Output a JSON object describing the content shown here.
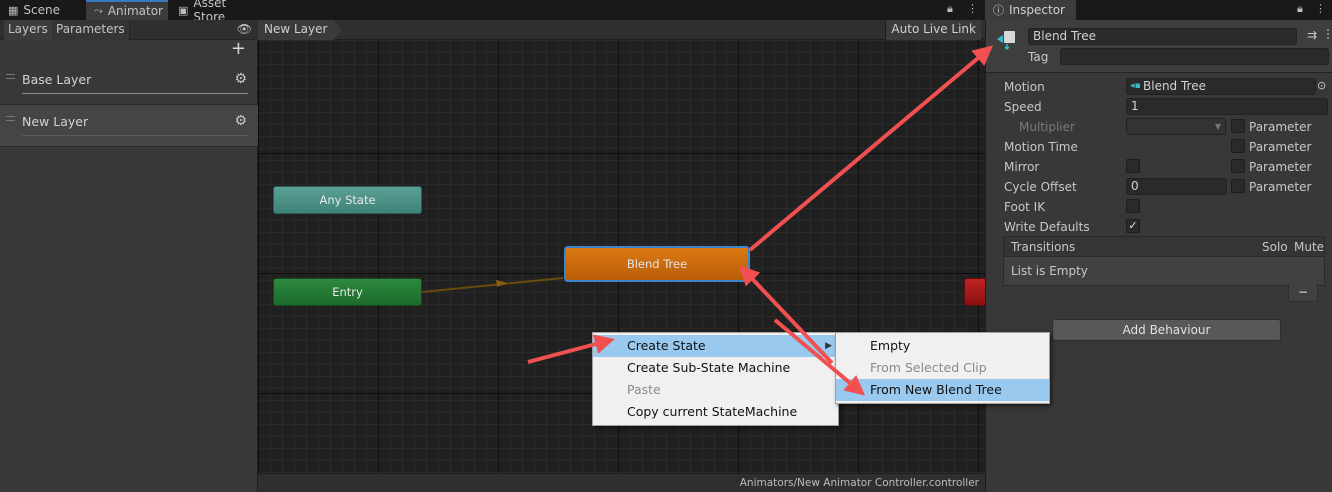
{
  "tabs": [
    {
      "label": "Scene",
      "icon": "grid-icon"
    },
    {
      "label": "Animator",
      "icon": "animator-icon"
    },
    {
      "label": "Asset Store",
      "icon": "bag-icon"
    }
  ],
  "layers_panel": {
    "tab_layers": "Layers",
    "tab_parameters": "Parameters",
    "add_symbol": "+",
    "layers": [
      {
        "name": "Base Layer"
      },
      {
        "name": "New Layer"
      }
    ]
  },
  "graph": {
    "breadcrumb": "New Layer",
    "auto_live_link": "Auto Live Link",
    "nodes": {
      "any_state": "Any State",
      "entry": "Entry",
      "blend_tree": "Blend Tree"
    },
    "footer_path": "Animators/New Animator Controller.controller"
  },
  "context_menu": {
    "items": [
      {
        "label": "Create State",
        "state": "highlighted",
        "has_submenu": true
      },
      {
        "label": "Create Sub-State Machine",
        "state": "normal"
      },
      {
        "label": "Paste",
        "state": "disabled"
      },
      {
        "label": "Copy current StateMachine",
        "state": "normal"
      }
    ]
  },
  "submenu": {
    "items": [
      {
        "label": "Empty",
        "state": "normal"
      },
      {
        "label": "From Selected Clip",
        "state": "disabled"
      },
      {
        "label": "From New Blend Tree",
        "state": "highlighted"
      }
    ]
  },
  "inspector": {
    "tab_label": "Inspector",
    "name": "Blend Tree",
    "tag_label": "Tag",
    "tag_value": "",
    "motion_label": "Motion",
    "motion_value": "Blend Tree",
    "speed_label": "Speed",
    "speed_value": "1",
    "multiplier_label": "Multiplier",
    "parameter_label": "Parameter",
    "motion_time_label": "Motion Time",
    "mirror_label": "Mirror",
    "cycle_offset_label": "Cycle Offset",
    "cycle_offset_value": "0",
    "foot_ik_label": "Foot IK",
    "write_defaults_label": "Write Defaults",
    "write_defaults_checked": true,
    "transitions_label": "Transitions",
    "solo_label": "Solo",
    "mute_label": "Mute",
    "list_empty": "List is Empty",
    "remove_symbol": "−",
    "add_behaviour": "Add Behaviour"
  },
  "colors": {
    "annotation_arrow": "#f05050",
    "node_blend_tree": "#c8680c",
    "node_any_state": "#4d9488",
    "node_entry": "#26803a",
    "menu_highlight": "#99c9ef"
  }
}
